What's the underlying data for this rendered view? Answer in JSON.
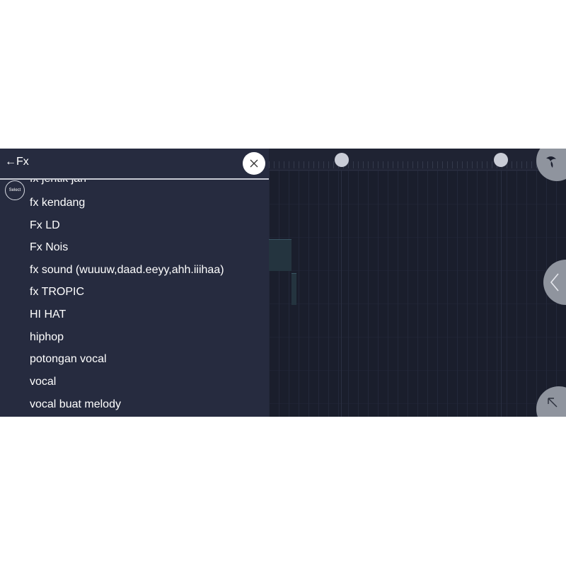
{
  "browser": {
    "back_label": "←Fx",
    "select_label": "Select",
    "items": [
      "fx jentik jari",
      "fx kendang",
      "Fx LD",
      "Fx Nois",
      "fx sound (wuuuw,daad.eeyy,ahh.iiihaa)",
      "fx TROPIC",
      "HI HAT",
      "hiphop",
      "potongan vocal",
      "vocal",
      "vocal buat melody"
    ]
  },
  "icons": {
    "close": "close-icon",
    "back": "back-arrow-icon",
    "menu": "fruit-logo-icon",
    "collapse": "chevron-left-icon",
    "expand": "arrow-up-left-icon"
  },
  "colors": {
    "panel_bg": "#262b3f",
    "playlist_bg": "#1a1e2c",
    "button_gray": "#8f949e"
  }
}
